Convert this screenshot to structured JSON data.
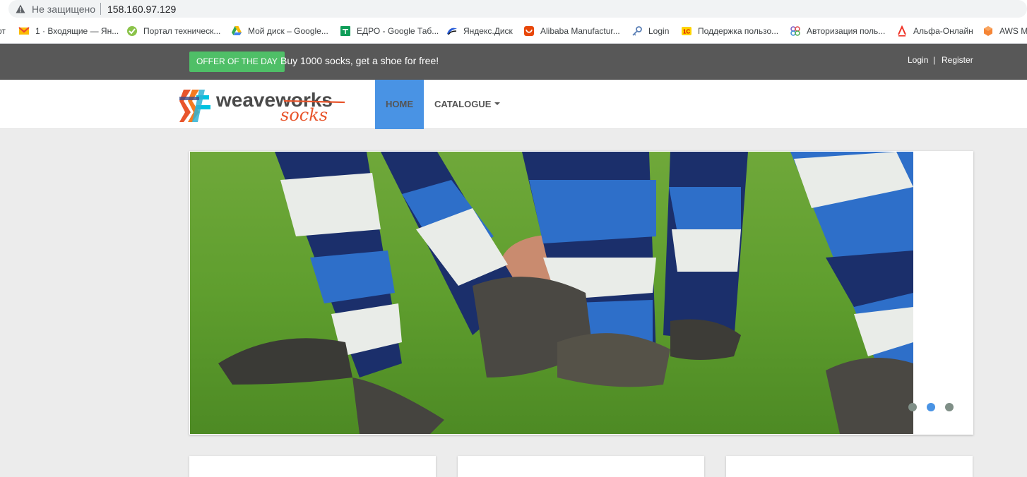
{
  "browser": {
    "security_label": "Не защищено",
    "url": "158.160.97.129"
  },
  "bookmarks": [
    {
      "label": "от",
      "icon": "bookmark-icon"
    },
    {
      "label": "1 · Входящие — Ян...",
      "icon": "mail-icon"
    },
    {
      "label": "Портал техническ...",
      "icon": "check-icon"
    },
    {
      "label": "Мой диск – Google...",
      "icon": "google-drive-icon"
    },
    {
      "label": "ЕДРО - Google Таб...",
      "icon": "google-sheets-icon"
    },
    {
      "label": "Яндекс.Диск",
      "icon": "yandex-disk-icon"
    },
    {
      "label": "Alibaba Manufactur...",
      "icon": "alibaba-icon"
    },
    {
      "label": "Login",
      "icon": "key-icon"
    },
    {
      "label": "Поддержка пользо...",
      "icon": "1c-icon"
    },
    {
      "label": "Авторизация поль...",
      "icon": "auth-icon"
    },
    {
      "label": "Альфа-Онлайн",
      "icon": "alfa-icon"
    },
    {
      "label": "AWS M",
      "icon": "aws-icon"
    }
  ],
  "offer": {
    "badge": "OFFER OF THE DAY",
    "text": "Buy 1000 socks, get a shoe for free!"
  },
  "account": {
    "login": "Login",
    "separator": "|",
    "register": "Register"
  },
  "logo": {
    "word1": "weaveworks",
    "word2": "socks"
  },
  "nav": {
    "home": "HOME",
    "catalogue": "CATALOGUE"
  },
  "carousel": {
    "slide_count": 3,
    "active_index": 1
  },
  "colors": {
    "offer_bar": "#585858",
    "offer_badge": "#4fbf67",
    "nav_active": "#4993e4",
    "page_bg": "#ececec"
  }
}
